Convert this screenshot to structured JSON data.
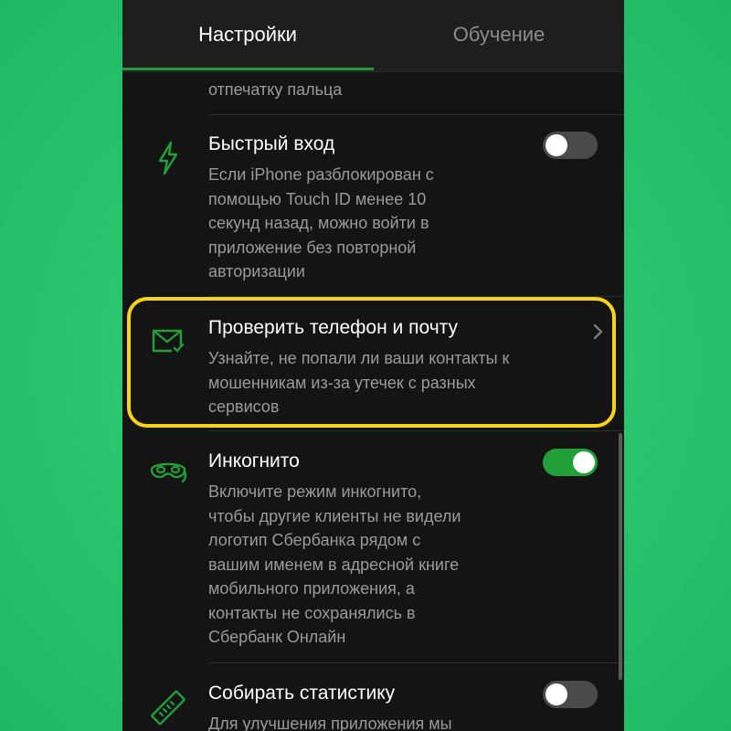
{
  "tabs": [
    {
      "label": "Настройки",
      "active": true
    },
    {
      "label": "Обучение",
      "active": false
    }
  ],
  "colors": {
    "accent": "#21a038",
    "background": "#141414",
    "highlight": "#f7d417",
    "page_background": "#27c46c"
  },
  "settings": {
    "prev_item_tail": "отпечатку пальца",
    "quick_login": {
      "icon": "lightning-icon",
      "title": "Быстрый вход",
      "description": [
        "Если iPhone разблокирован с",
        "помощью Touch ID менее 10",
        "секунд назад, можно войти в",
        "приложение без повторной",
        "авторизации"
      ],
      "toggle_on": false
    },
    "check_contacts": {
      "icon": "mail-check-icon",
      "title": "Проверить телефон и почту",
      "description": [
        "Узнайте, не попали ли ваши контакты к",
        "мошенникам из-за утечек с разных",
        "сервисов"
      ]
    },
    "incognito": {
      "icon": "mask-icon",
      "title": "Инкогнито",
      "description": [
        "Включите режим инкогнито,",
        "чтобы другие клиенты не видели",
        "логотип Сбербанка рядом с",
        "вашим именем в адресной книге",
        "мобильного приложения, а",
        "контакты не сохранялись в",
        "Сбербанк Онлайн"
      ],
      "toggle_on": true
    },
    "statistics": {
      "icon": "ruler-icon",
      "title": "Собирать статистику",
      "description": [
        "Для улучшения приложения мы"
      ],
      "toggle_on": false
    }
  }
}
